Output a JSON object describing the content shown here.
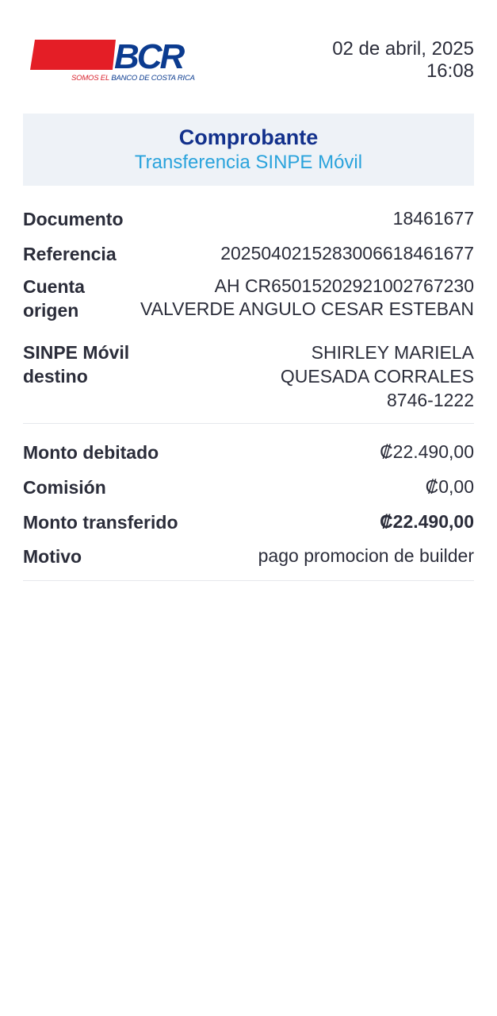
{
  "brand": {
    "logo_text": "BCR",
    "tagline_red": "SOMOS EL",
    "tagline_blue": "BANCO DE COSTA RICA",
    "colors": {
      "red": "#e41e26",
      "blue": "#13318c",
      "accent": "#2aa3dc"
    }
  },
  "header": {
    "date": "02 de abril, 2025",
    "time": "16:08"
  },
  "title": {
    "main": "Comprobante",
    "sub": "Transferencia SINPE Móvil"
  },
  "details": {
    "documento": {
      "label": "Documento",
      "value": "18461677"
    },
    "referencia": {
      "label": "Referencia",
      "value": "2025040215283006618461677"
    },
    "cuenta_origen": {
      "label_line1": "Cuenta",
      "label_line2": "origen",
      "value_line1": "AH CR65015202921002767230",
      "value_line2": "VALVERDE ANGULO CESAR ESTEBAN"
    },
    "sinpe_destino": {
      "label_line1": "SINPE Móvil",
      "label_line2": "destino",
      "value_line1": "SHIRLEY MARIELA",
      "value_line2": "QUESADA CORRALES",
      "value_line3": "8746-1222"
    }
  },
  "amounts": {
    "monto_debitado": {
      "label": "Monto debitado",
      "value": "₡22.490,00"
    },
    "comision": {
      "label": "Comisión",
      "value": "₡0,00"
    },
    "monto_transferido": {
      "label": "Monto transferido",
      "value": "₡22.490,00"
    },
    "motivo": {
      "label": "Motivo",
      "value": "pago promocion de builder"
    }
  }
}
